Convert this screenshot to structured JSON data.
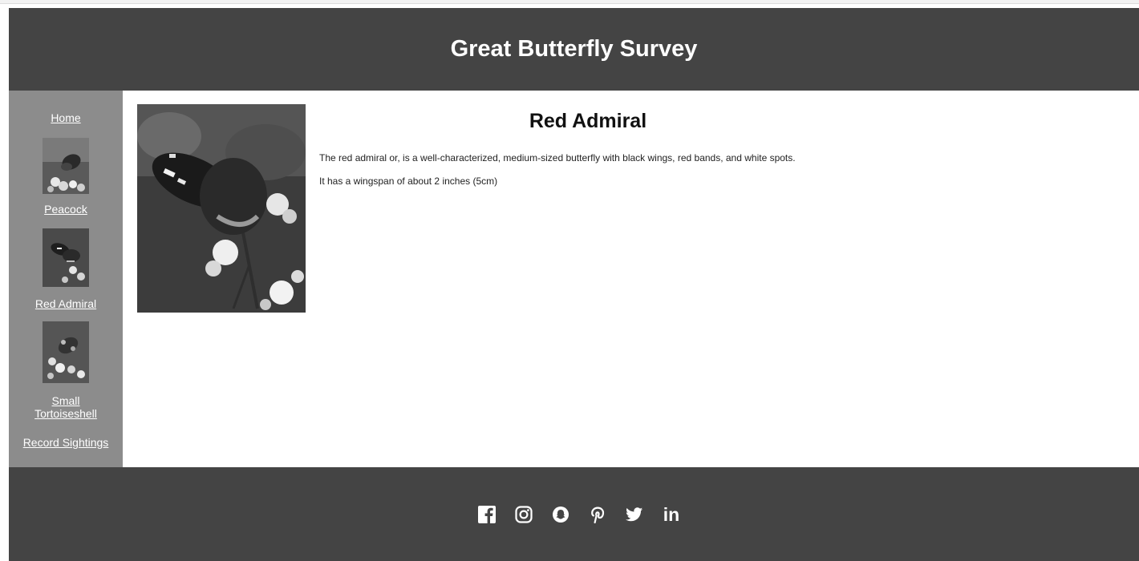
{
  "header": {
    "title": "Great Butterfly Survey"
  },
  "sidebar": {
    "home": "Home",
    "peacock": "Peacock",
    "red_admiral": "Red Admiral",
    "small_tortoiseshell_line1": "Small",
    "small_tortoiseshell_line2": "Tortoiseshell",
    "record": "Record Sightings"
  },
  "main": {
    "title": "Red Admiral",
    "paragraph1": "The red admiral or, is a well-characterized, medium-sized butterfly with black wings, red bands, and white spots.",
    "paragraph2": "It has a wingspan of about 2 inches (5cm)"
  },
  "footer": {
    "icons": [
      "facebook-icon",
      "instagram-icon",
      "snapchat-icon",
      "pinterest-icon",
      "twitter-icon",
      "linkedin-icon"
    ],
    "linkedin_glyph": "in"
  },
  "colors": {
    "header_bg": "#444444",
    "sidebar_bg": "#8c8c8c",
    "page_bg": "#ffffff",
    "link": "#ffffff"
  }
}
